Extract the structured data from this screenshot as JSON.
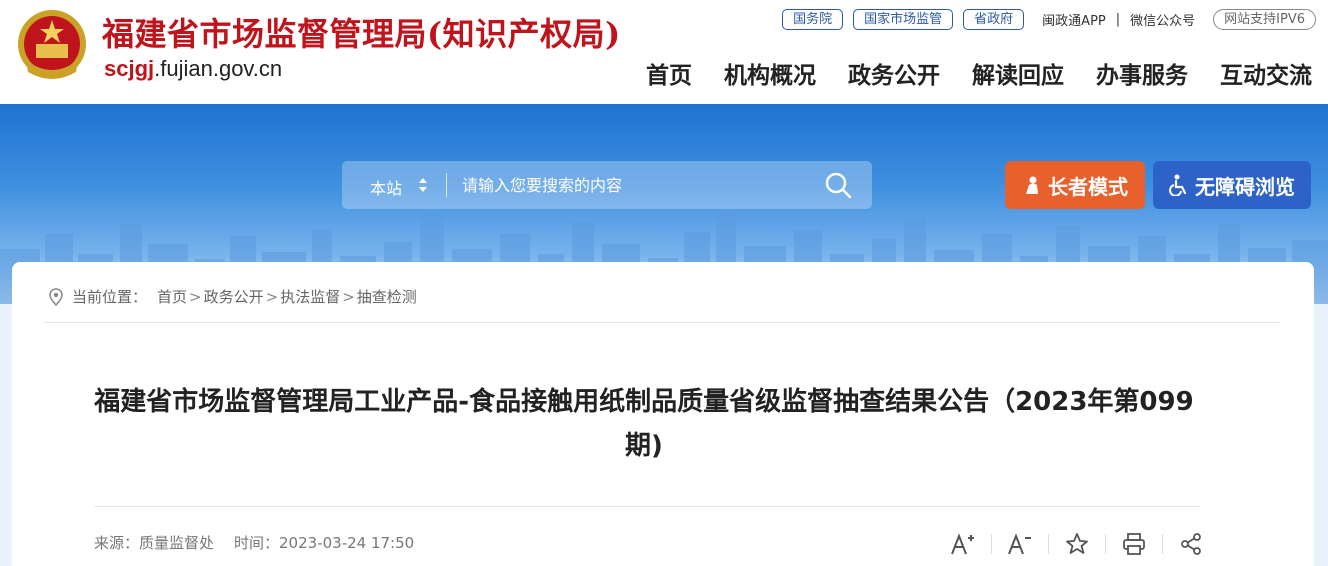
{
  "header": {
    "title": "福建省市场监督管理局(知识产权局)",
    "domain_highlight": "scjgj",
    "domain_rest": ".fujian.gov.cn",
    "top_links": {
      "pills": [
        "国务院",
        "国家市场监管",
        "省政府"
      ],
      "app": "闽政通APP",
      "separator": "|",
      "wechat": "微信公众号",
      "ipv6": "网站支持IPV6"
    },
    "nav": [
      "首页",
      "机构概况",
      "政务公开",
      "解读回应",
      "办事服务",
      "互动交流"
    ]
  },
  "search": {
    "scope": "本站",
    "placeholder": "请输入您要搜索的内容"
  },
  "buttons": {
    "elder_mode": "长者模式",
    "accessible": "无障碍浏览"
  },
  "breadcrumb": {
    "label": "当前位置：",
    "items": [
      "首页",
      "政务公开",
      "执法监督",
      "抽查检测"
    ],
    "separator": ">"
  },
  "article": {
    "title": "福建省市场监督管理局工业产品-食品接触用纸制品质量省级监督抽查结果公告（2023年第099期)",
    "source": "来源：质量监督处",
    "time": "时间：2023-03-24 17:50"
  },
  "tools": [
    "font-increase-icon",
    "font-decrease-icon",
    "favorite-icon",
    "print-icon",
    "share-icon"
  ],
  "colors": {
    "brand_red": "#c0141c",
    "link_blue": "#2c5aa0",
    "elder_orange": "#e8612c",
    "access_blue": "#2d63c8"
  }
}
